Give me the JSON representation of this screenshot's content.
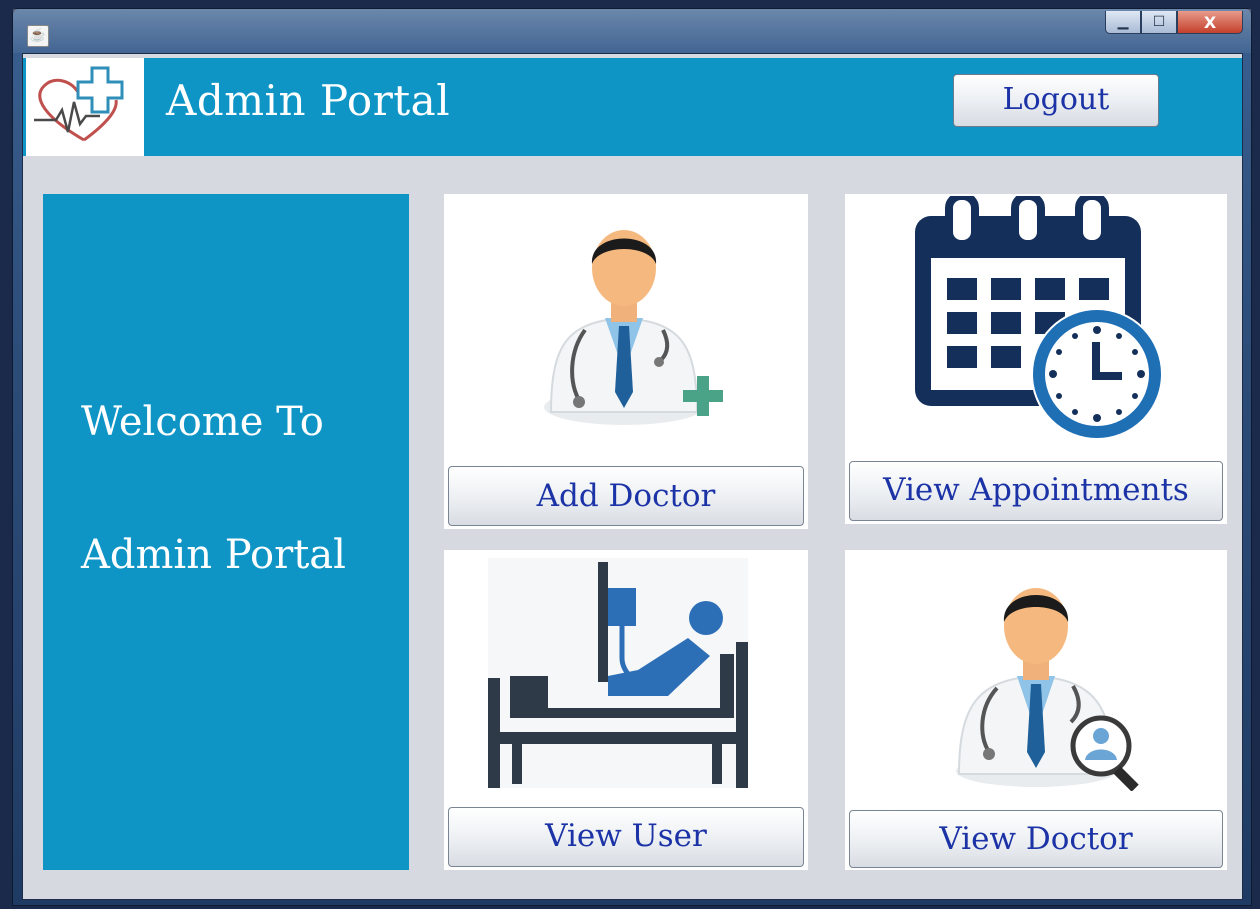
{
  "window": {
    "app_icon": "java-cup-icon",
    "controls": {
      "minimize": "▁",
      "maximize": "☐",
      "close": "X"
    }
  },
  "header": {
    "logo": "heart-cross-logo",
    "title": "Admin Portal",
    "logout_label": "Logout"
  },
  "welcome": {
    "line1": "Welcome To",
    "line2": "Admin Portal"
  },
  "cards": {
    "add_doctor": {
      "icon": "doctor-add-icon",
      "label": "Add Doctor"
    },
    "view_appointments": {
      "icon": "calendar-clock-icon",
      "label": "View Appointments"
    },
    "view_user": {
      "icon": "hospital-bed-patient-icon",
      "label": "View User"
    },
    "view_doctor": {
      "icon": "doctor-search-icon",
      "label": "View Doctor"
    }
  },
  "colors": {
    "brand_blue": "#0e95c6",
    "button_text": "#1b33a6",
    "background": "#d6d9df",
    "calendar_navy": "#14305a",
    "clock_blue": "#1f6fb5",
    "plus_teal": "#4aa287"
  }
}
